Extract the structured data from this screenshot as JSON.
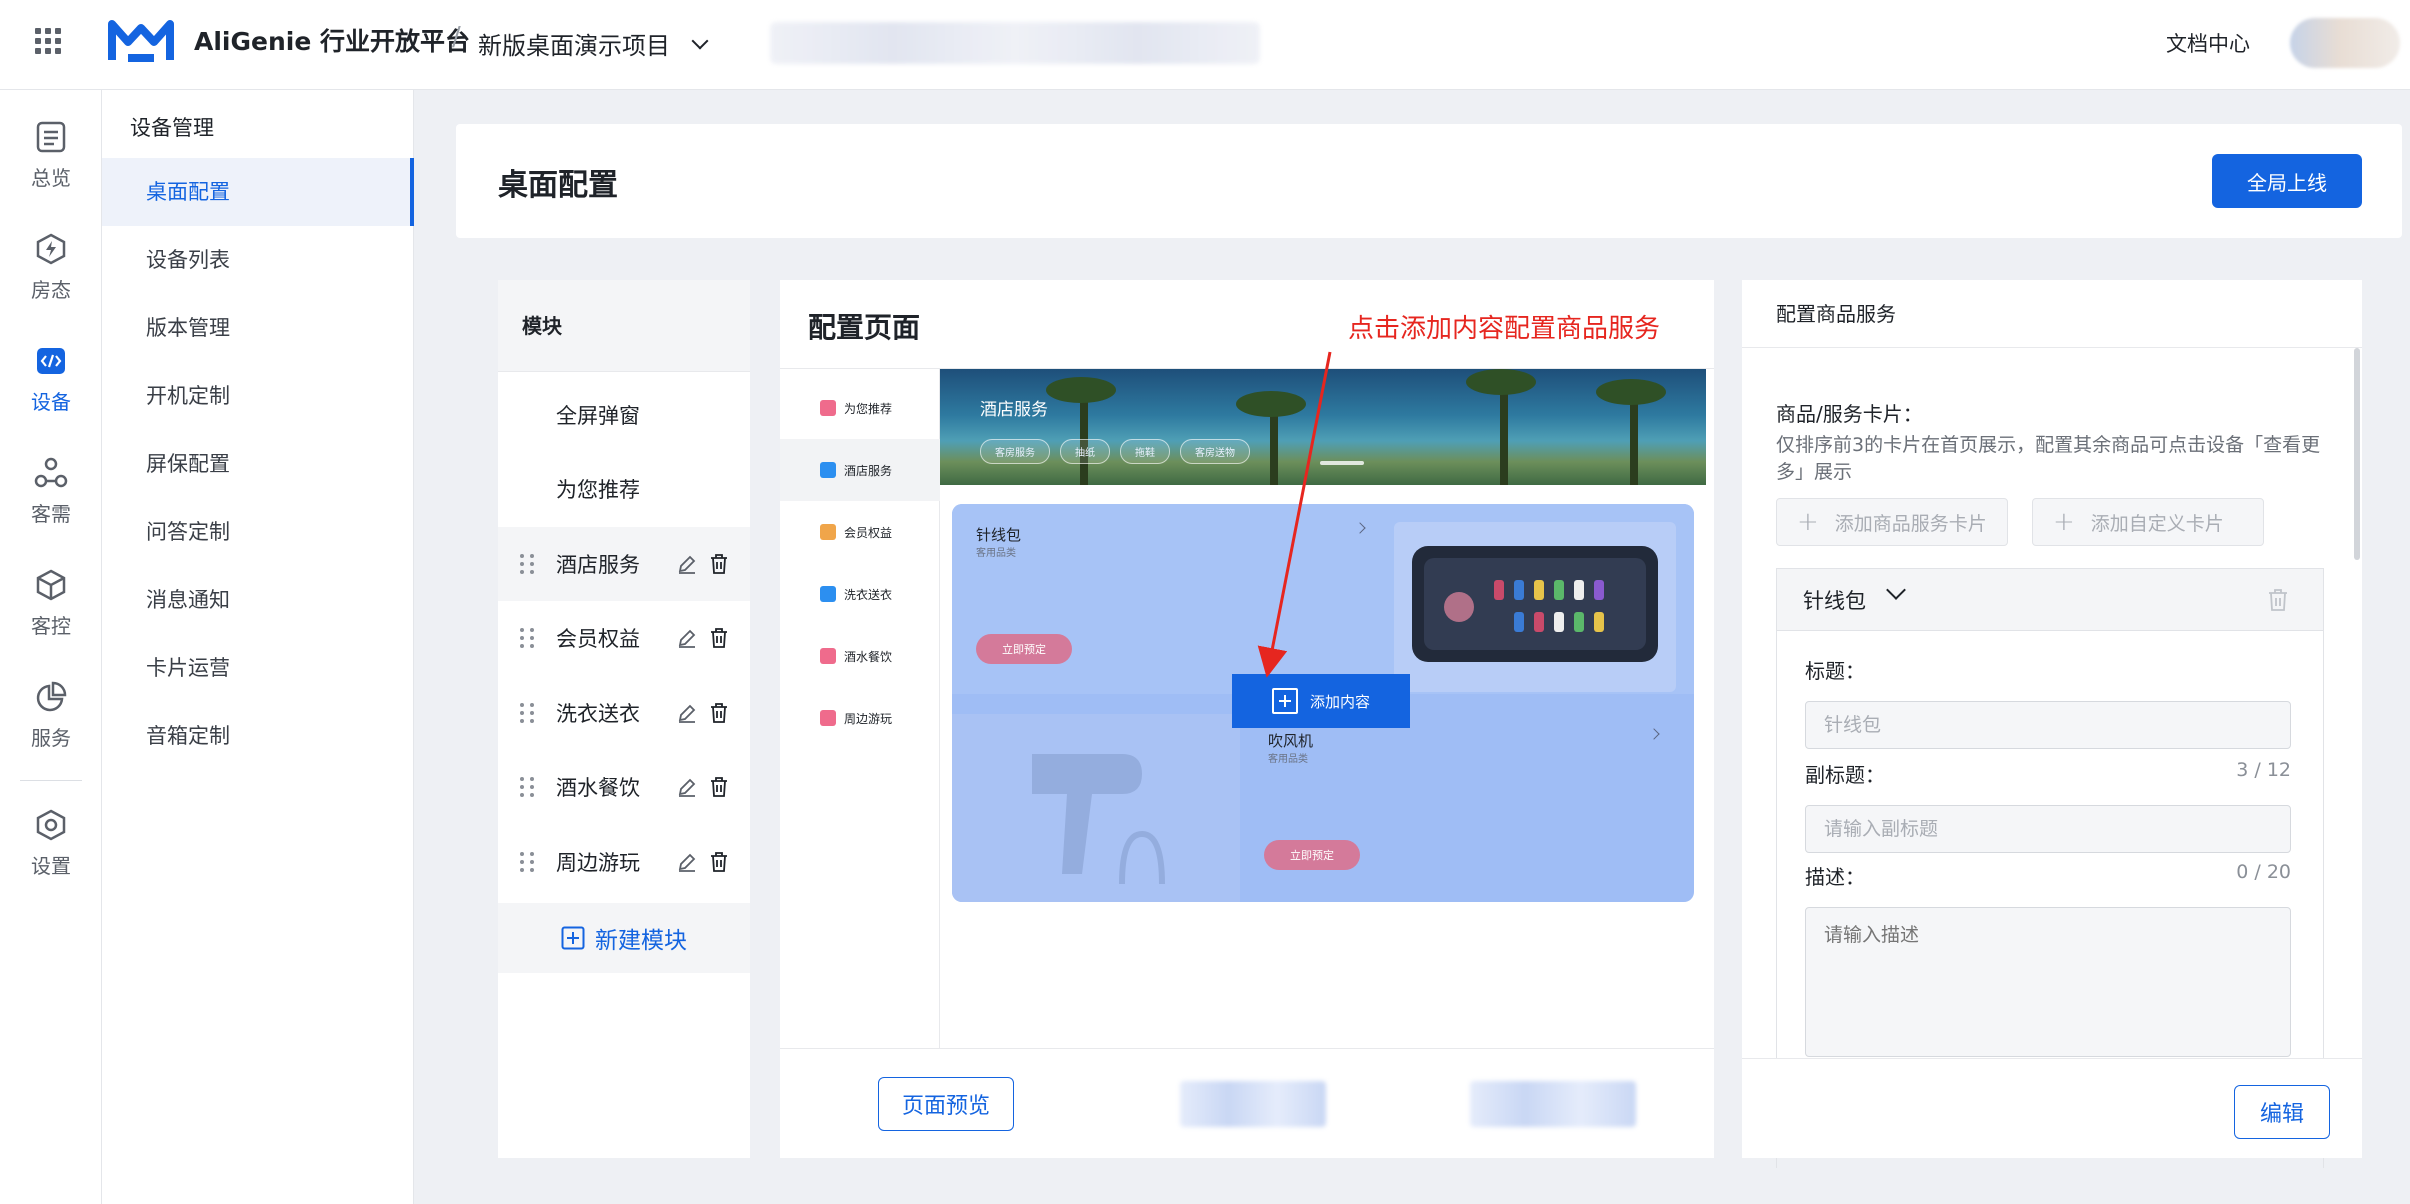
{
  "topbar": {
    "brand": "AliGenie 行业开放平台",
    "separator": "/",
    "project": "新版桌面演示项目",
    "doc_center": "文档中心"
  },
  "rail": {
    "items": [
      {
        "label": "总览",
        "icon": "overview-icon"
      },
      {
        "label": "房态",
        "icon": "room-status-icon"
      },
      {
        "label": "设备",
        "icon": "device-code-icon"
      },
      {
        "label": "客需",
        "icon": "guest-needs-icon"
      },
      {
        "label": "客控",
        "icon": "guest-control-icon"
      },
      {
        "label": "服务",
        "icon": "service-chart-icon"
      },
      {
        "label": "设置",
        "icon": "settings-icon"
      }
    ],
    "active": "设备"
  },
  "subnav": {
    "title": "设备管理",
    "items": [
      "桌面配置",
      "设备列表",
      "版本管理",
      "开机定制",
      "屏保配置",
      "问答定制",
      "消息通知",
      "卡片运营",
      "音箱定制"
    ],
    "active": "桌面配置"
  },
  "header": {
    "title": "桌面配置",
    "publish_button": "全局上线"
  },
  "modules": {
    "title": "模块",
    "items": [
      "全屏弹窗",
      "为您推荐",
      "酒店服务",
      "会员权益",
      "洗衣送衣",
      "酒水餐饮",
      "周边游玩"
    ],
    "new_button": "新建模块"
  },
  "config": {
    "title": "配置页面",
    "annotation": "点击添加内容配置商品服务",
    "preview_nav": [
      "为您推荐",
      "酒店服务",
      "会员权益",
      "洗衣送衣",
      "酒水餐饮",
      "周边游玩"
    ],
    "banner": {
      "title": "酒店服务",
      "tags": [
        "客房服务",
        "抽纸",
        "拖鞋",
        "客房送物"
      ]
    },
    "product_a": {
      "title": "针线包",
      "subtitle": "客用品类",
      "button": "立即预定"
    },
    "product_b": {
      "title": "吹风机",
      "subtitle": "客用品类",
      "button": "立即预定"
    },
    "add_content": "添加内容",
    "preview_button": "页面预览"
  },
  "right_panel": {
    "title": "配置商品服务",
    "cards_label": "商品/服务卡片：",
    "help": "仅排序前3的卡片在首页展示，配置其余商品可点击设备「查看更多」展示",
    "add_product_card": "添加商品服务卡片",
    "add_custom_card": "添加自定义卡片",
    "item_name": "针线包",
    "title_label": "标题：",
    "title_placeholder": "针线包",
    "subtitle_label": "副标题：",
    "subtitle_count": "3 / 12",
    "subtitle_placeholder": "请输入副标题",
    "desc_label": "描述：",
    "desc_count": "0 / 20",
    "desc_placeholder": "请输入描述",
    "edit_button": "编辑"
  },
  "colors": {
    "accent": "#1464e0",
    "annotation": "#e6261f",
    "selection": "#9fbdf5"
  }
}
